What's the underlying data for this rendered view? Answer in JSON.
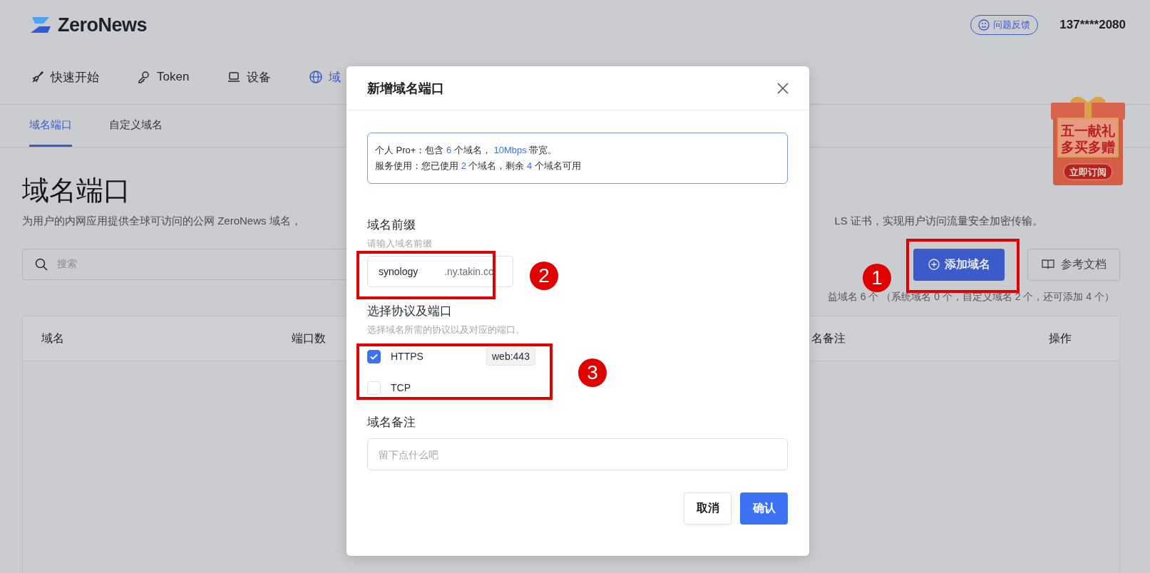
{
  "header": {
    "logo": "ZeroNews",
    "feedback_button": "问题反馈",
    "user": "137****2080"
  },
  "nav": [
    {
      "label": "快速开始",
      "selected": false
    },
    {
      "label": "Token",
      "selected": false
    },
    {
      "label": "设备",
      "selected": false
    },
    {
      "label": "域",
      "selected": true
    }
  ],
  "tabs": [
    {
      "label": "域名端口",
      "selected": true
    },
    {
      "label": "自定义域名",
      "selected": false
    }
  ],
  "page": {
    "title": "域名端口",
    "description_left": "为用户的内网应用提供全球可访问的公网 ZeroNews 域名，",
    "description_right": "LS 证书，实现用户访问流量安全加密传输。",
    "search": {
      "placeholder": "搜索"
    },
    "add_button": "添加域名",
    "docs_button": "参考文档",
    "quota_note": "益域名 6 个 （系统域名 0 个，自定义域名 2 个，还可添加 4 个）"
  },
  "promo": {
    "lines": [
      "五一献礼",
      "多买多赠"
    ],
    "button": "立即订阅"
  },
  "table": {
    "columns": [
      "域名",
      "端口数",
      "名备注",
      "操作"
    ]
  },
  "dialog": {
    "title": "新增域名端口",
    "info": [
      [
        {
          "text": "个人 Pro+：包含 ",
          "highlight": false
        },
        {
          "text": "6",
          "highlight": true
        },
        {
          "text": " 个域名， ",
          "highlight": false
        },
        {
          "text": "10Mbps",
          "highlight": true
        },
        {
          "text": " 带宽。",
          "highlight": false
        }
      ],
      [
        {
          "text": "服务使用：您已使用 ",
          "highlight": false
        },
        {
          "text": "2",
          "highlight": true
        },
        {
          "text": " 个域名，剩余 ",
          "highlight": false
        },
        {
          "text": "4",
          "highlight": true
        },
        {
          "text": " 个域名可用",
          "highlight": false
        }
      ]
    ],
    "prefix": {
      "label": "域名前缀",
      "hint": "请输入域名前缀",
      "value": "synology",
      "suffix": ".ny.takin.cc"
    },
    "protocol": {
      "label": "选择协议及端口",
      "hint": "选择域名所需的协议以及对应的端口。",
      "options": [
        {
          "label": "HTTPS",
          "checked": true,
          "port": "web:443"
        },
        {
          "label": "TCP",
          "checked": false
        }
      ]
    },
    "note": {
      "label": "域名备注",
      "placeholder": "留下点什么吧"
    },
    "cancel_button": "取消",
    "confirm_button": "确认"
  },
  "annotations": [
    {
      "number": "1"
    },
    {
      "number": "2"
    },
    {
      "number": "3"
    }
  ]
}
